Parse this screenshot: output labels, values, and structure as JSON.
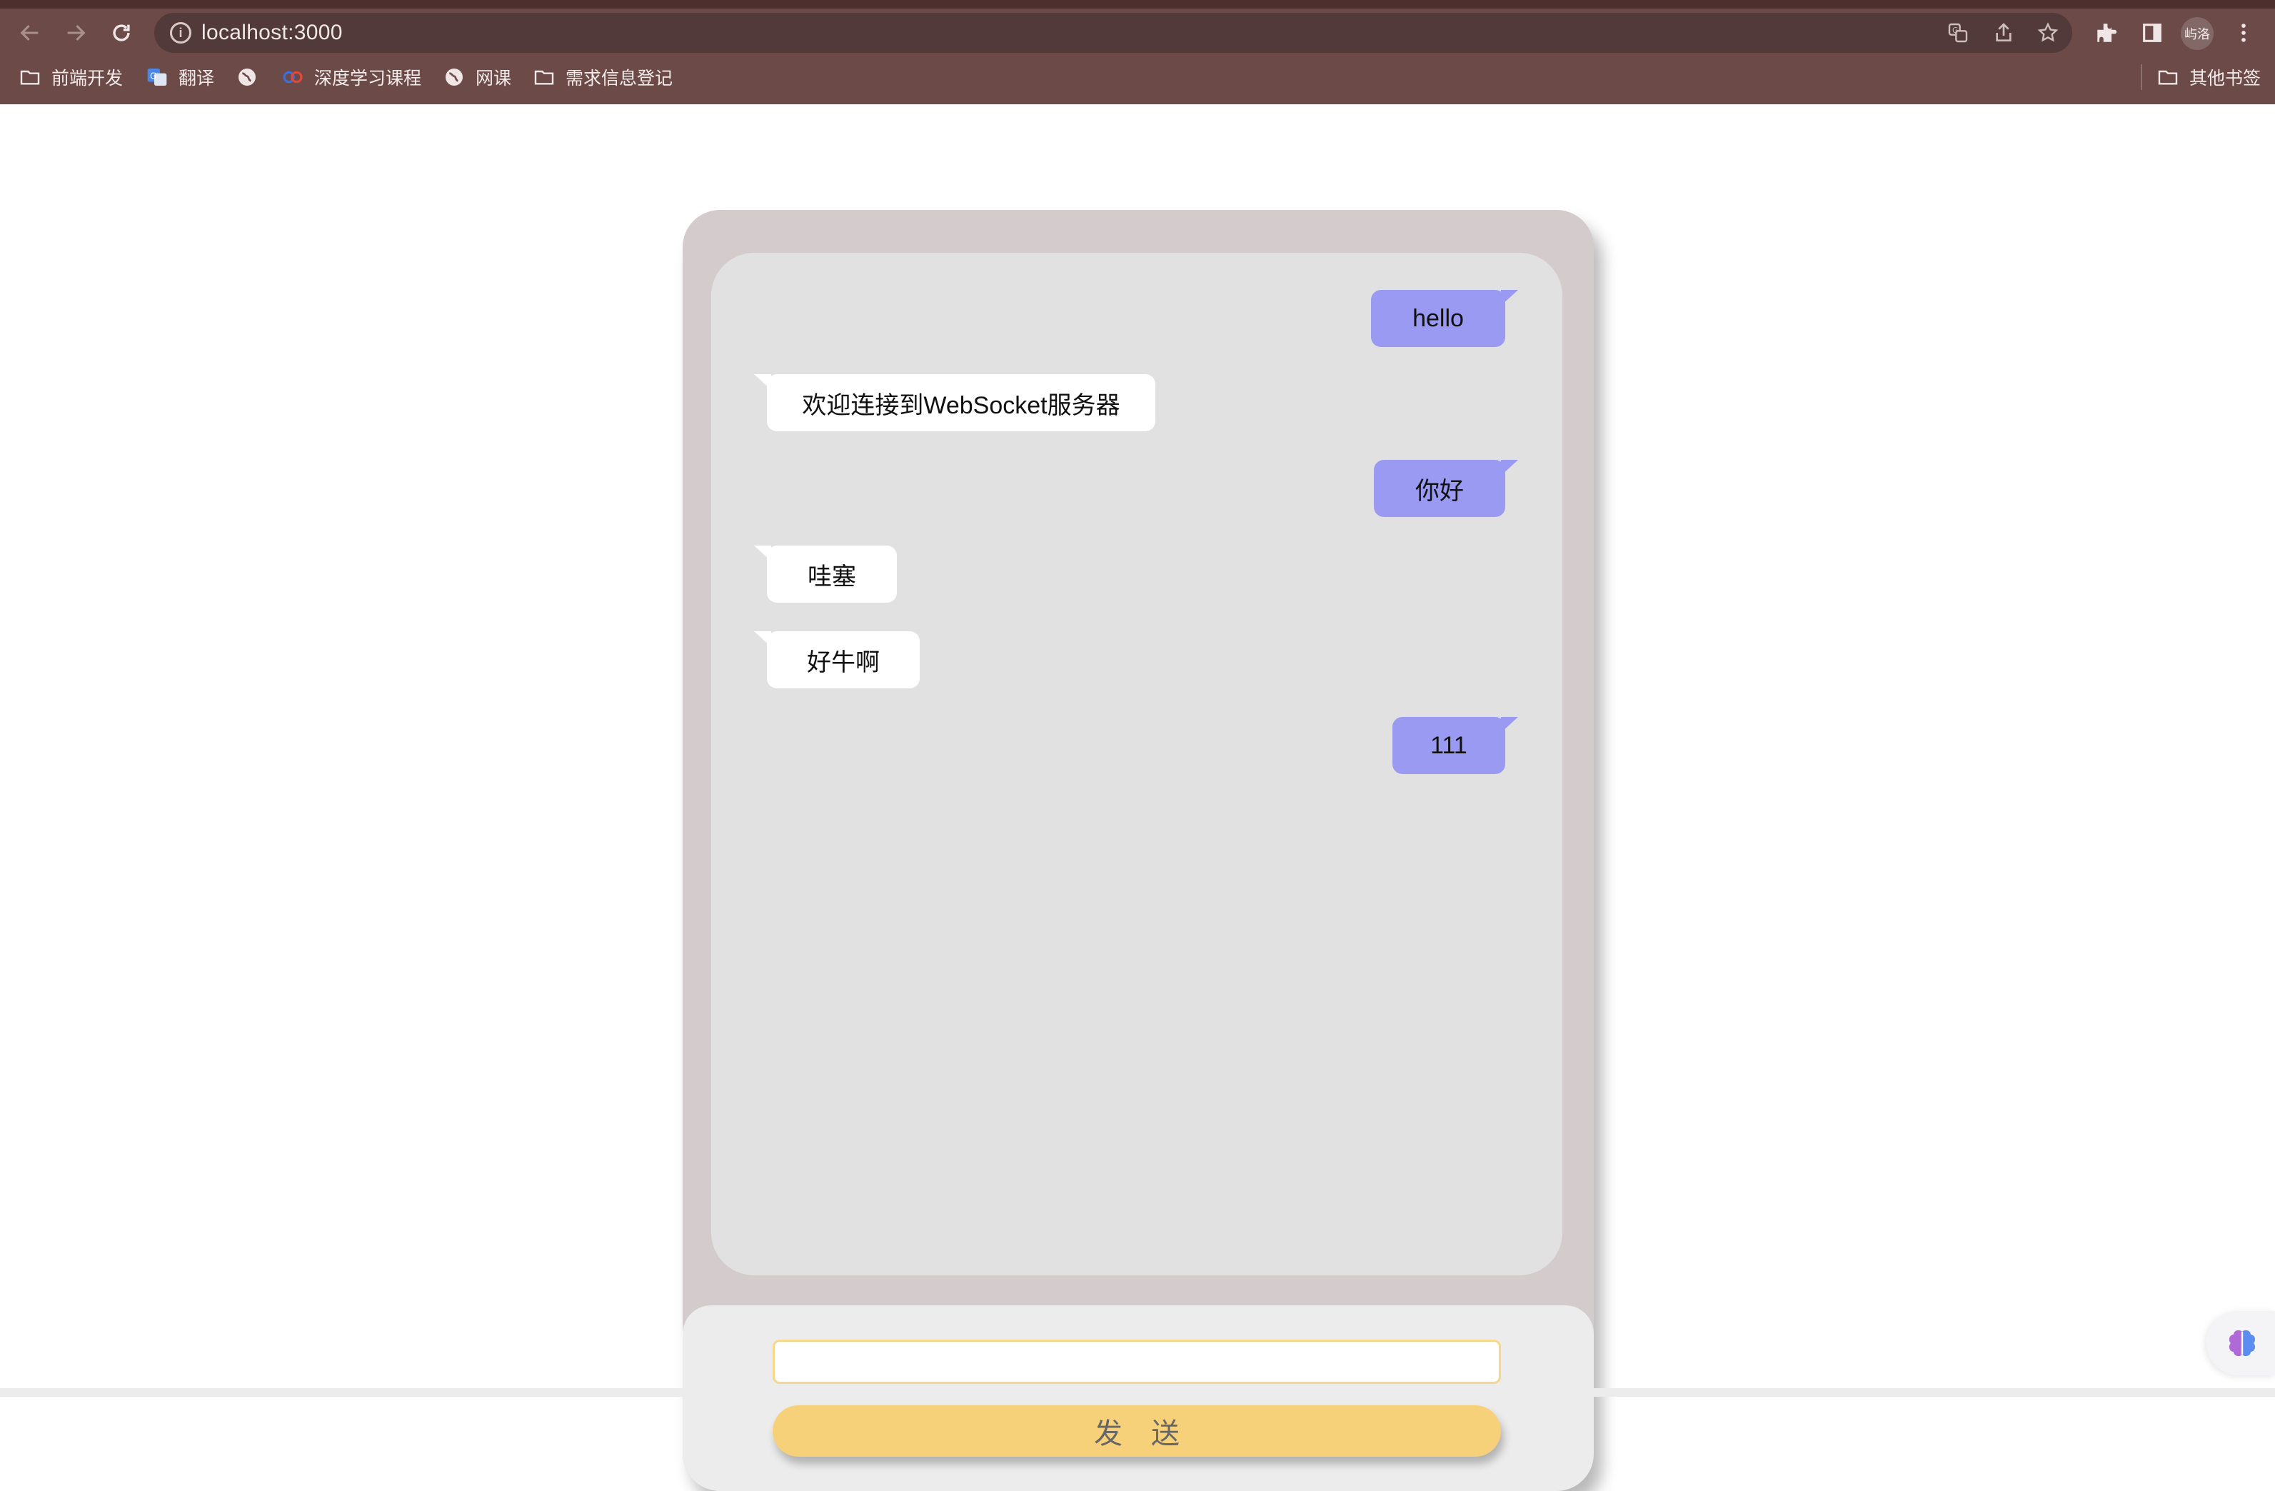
{
  "browser": {
    "url": "localhost:3000",
    "profile_label": "屿洛",
    "bookmarks": [
      {
        "label": "前端开发",
        "icon": "folder-icon"
      },
      {
        "label": "翻译",
        "icon": "google-translate-icon"
      },
      {
        "label": "",
        "icon": "globe-icon"
      },
      {
        "label": "深度学习课程",
        "icon": "course-logo-icon"
      },
      {
        "label": "网课",
        "icon": "globe-icon"
      },
      {
        "label": "需求信息登记",
        "icon": "folder-icon"
      }
    ],
    "other_bookmarks": "其他书签"
  },
  "chat": {
    "messages": [
      {
        "side": "right",
        "text": "hello"
      },
      {
        "side": "left",
        "text": "欢迎连接到WebSocket服务器"
      },
      {
        "side": "right",
        "text": "你好"
      },
      {
        "side": "left",
        "text": "哇塞"
      },
      {
        "side": "left",
        "text": "好牛啊"
      },
      {
        "side": "right",
        "text": "111"
      }
    ],
    "input_value": "",
    "send_label": "发送"
  },
  "colors": {
    "chrome": "#6b4a47",
    "card": "#d3cbcc",
    "messages_bg": "#e1e1e1",
    "bubble_right": "#9a9af2",
    "bubble_left": "#ffffff",
    "send_button": "#f7d17a"
  }
}
